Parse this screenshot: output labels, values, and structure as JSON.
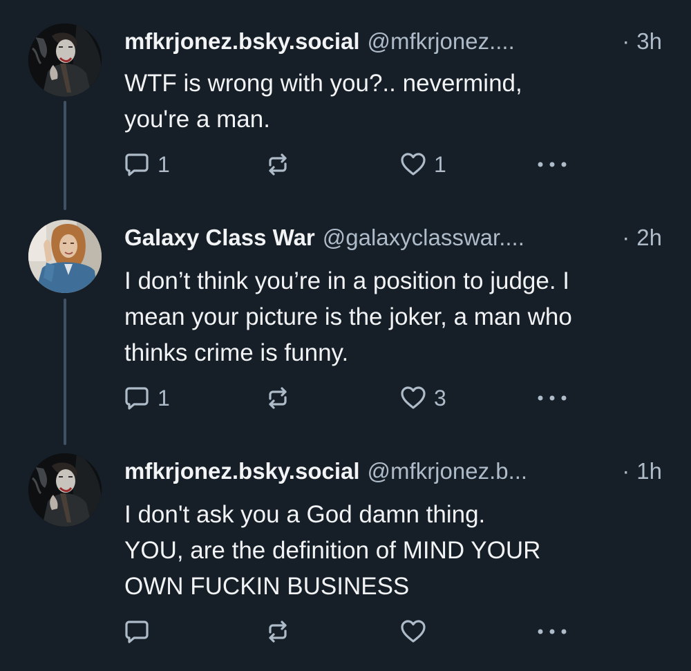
{
  "colors": {
    "background": "#161e27",
    "text_primary": "#f1f3f5",
    "text_secondary": "#aebbc9",
    "thread_line": "#3f5163"
  },
  "posts": [
    {
      "display_name": "mfkrjonez.bsky.social",
      "handle": "@mfkrjonez....",
      "separator": "·",
      "time": "3h",
      "avatar": "joker-avatar",
      "text_lines": [
        "WTF is wrong with you?.. nevermind,",
        "you're a man."
      ],
      "reply_count": "1",
      "like_count": "1",
      "icons": [
        "reply-icon",
        "repost-icon",
        "like-icon",
        "more-icon"
      ]
    },
    {
      "display_name": "Galaxy Class War",
      "handle": "@galaxyclasswar....",
      "separator": "·",
      "time": "2h",
      "avatar": "woman-avatar",
      "text_lines": [
        "I don’t think you’re in a position to judge. I",
        "mean your picture is the joker, a man who",
        "thinks crime is funny."
      ],
      "reply_count": "1",
      "like_count": "3",
      "icons": [
        "reply-icon",
        "repost-icon",
        "like-icon",
        "more-icon"
      ]
    },
    {
      "display_name": "mfkrjonez.bsky.social",
      "handle": "@mfkrjonez.b...",
      "separator": "·",
      "time": "1h",
      "avatar": "joker-avatar",
      "text_lines": [
        "I don't ask you a God damn thing.",
        "YOU, are the definition of MIND YOUR",
        "OWN FUCKIN BUSINESS"
      ],
      "reply_count": "",
      "like_count": "",
      "icons": [
        "reply-icon",
        "repost-icon",
        "like-icon",
        "more-icon"
      ]
    }
  ]
}
